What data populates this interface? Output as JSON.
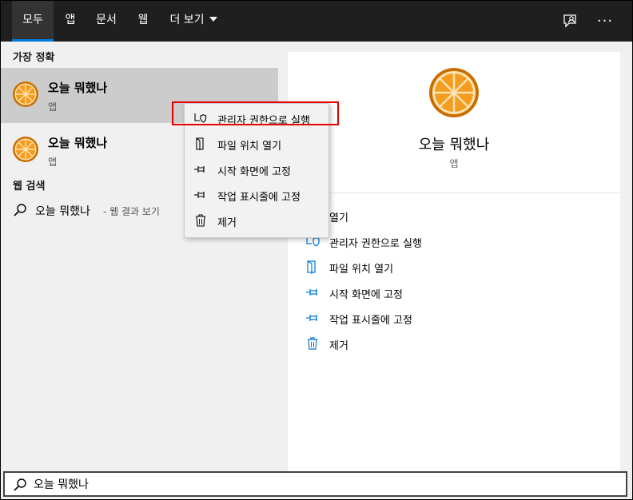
{
  "tabs": [
    {
      "label": "모두",
      "active": true
    },
    {
      "label": "앱"
    },
    {
      "label": "문서"
    },
    {
      "label": "웹"
    },
    {
      "label": "더 보기"
    }
  ],
  "top_icons": [
    "feedback-icon",
    "more-icon"
  ],
  "more_glyph": "···",
  "best_match": {
    "title": "가장 정확",
    "results": [
      {
        "name": "오늘 뭐했나",
        "type": "앱",
        "icon": "orange-slice-icon"
      },
      {
        "name": "오늘 뭐했나",
        "type": "앱",
        "icon": "orange-slice-icon"
      }
    ]
  },
  "web_search": {
    "title": "웹 검색",
    "query": "오늘 뭐했나",
    "suffix": "- 웹 결과 보기"
  },
  "context_menu": {
    "items": [
      {
        "label": "관리자 권한으로 실행",
        "icon": "admin-shield-icon",
        "highlighted": true
      },
      {
        "label": "파일 위치 열기",
        "icon": "folder-open-icon"
      },
      {
        "label": "시작 화면에 고정",
        "icon": "pin-icon"
      },
      {
        "label": "작업 표시줄에 고정",
        "icon": "pin-icon"
      },
      {
        "label": "제거",
        "icon": "trash-icon"
      }
    ]
  },
  "detail": {
    "app_name": "오늘 뭐했나",
    "app_type": "앱",
    "actions": [
      {
        "label": "열기",
        "icon": "open-icon"
      },
      {
        "label": "관리자 권한으로 실행",
        "icon": "admin-shield-icon"
      },
      {
        "label": "파일 위치 열기",
        "icon": "folder-open-icon"
      },
      {
        "label": "시작 화면에 고정",
        "icon": "pin-icon"
      },
      {
        "label": "작업 표시줄에 고정",
        "icon": "pin-icon"
      },
      {
        "label": "제거",
        "icon": "trash-icon"
      }
    ]
  },
  "search": {
    "value": "오늘 뭐했나"
  },
  "colors": {
    "accent": "#0078d7",
    "topbar": "#1f1f1f",
    "highlight_box": "#e60000",
    "orange": "#f39c1f"
  }
}
